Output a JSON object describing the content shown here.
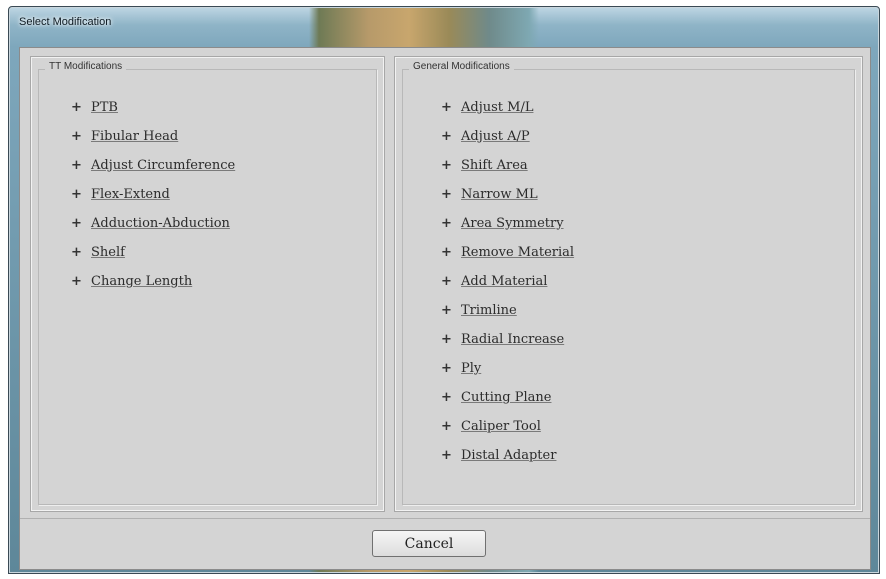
{
  "window": {
    "title": "Select Modification"
  },
  "tt_modifications": {
    "legend": "TT Modifications",
    "items": [
      "PTB",
      "Fibular Head",
      "Adjust Circumference",
      "Flex-Extend",
      "Adduction-Abduction",
      "Shelf",
      "Change Length"
    ]
  },
  "general_modifications": {
    "legend": "General Modifications",
    "items": [
      "Adjust M/L",
      "Adjust A/P",
      "Shift Area",
      "Narrow ML",
      "Area Symmetry",
      "Remove Material",
      "Add Material",
      "Trimline",
      "Radial Increase",
      "Ply",
      "Cutting Plane",
      "Caliper Tool",
      "Distal Adapter"
    ]
  },
  "footer": {
    "cancel_label": "Cancel"
  },
  "icons": {
    "item_bullet": "plus-icon"
  }
}
